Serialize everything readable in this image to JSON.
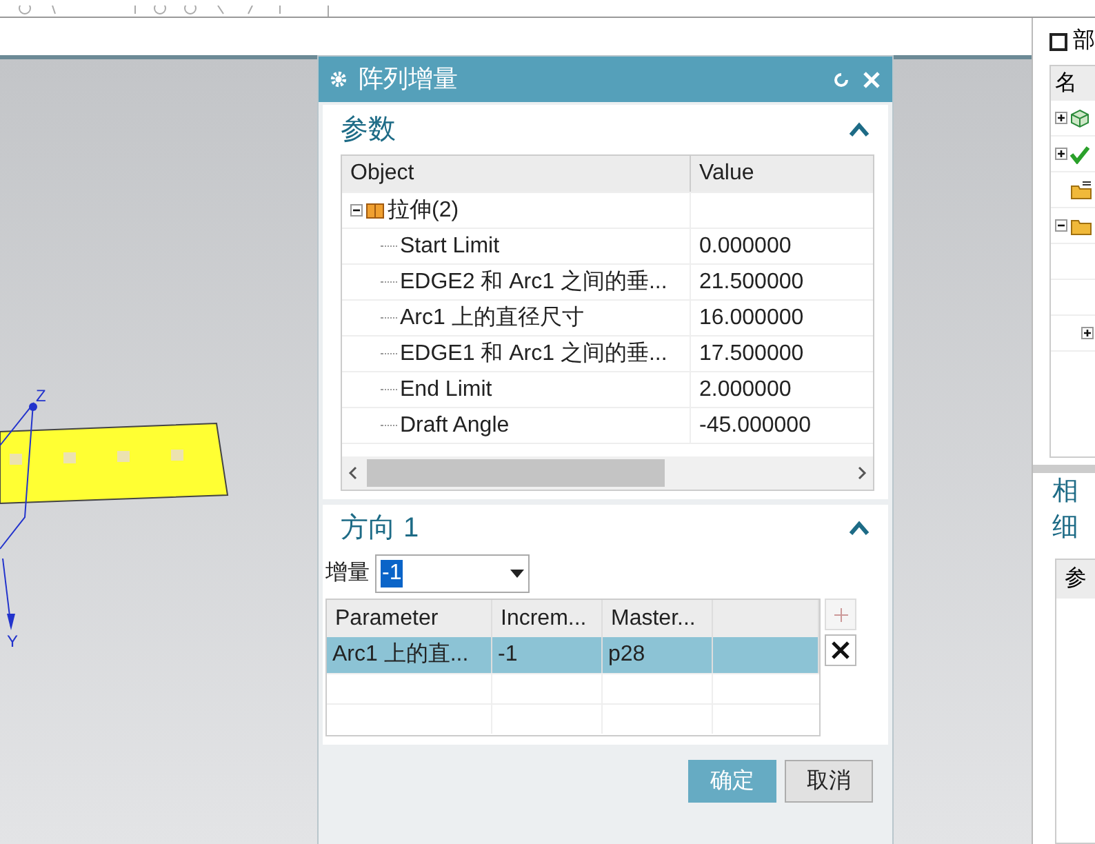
{
  "viewport": {
    "axis_labels": [
      "Z",
      "Y"
    ]
  },
  "dialog": {
    "title": "阵列增量",
    "parameters_section": {
      "title": "参数",
      "expanded": true,
      "table": {
        "columns": [
          "Object",
          "Value"
        ],
        "rows": [
          {
            "object": "拉伸(2)",
            "value": "",
            "expanded": true,
            "children": [
              {
                "object": "Start Limit",
                "value": "0.000000"
              },
              {
                "object": "EDGE2 和 Arc1 之间的垂...",
                "value": "21.500000"
              },
              {
                "object": "Arc1 上的直径尺寸",
                "value": "16.000000"
              },
              {
                "object": "EDGE1 和 Arc1 之间的垂...",
                "value": "17.500000"
              },
              {
                "object": "End Limit",
                "value": "2.000000"
              },
              {
                "object": "Draft Angle",
                "value": "-45.000000"
              }
            ]
          }
        ]
      }
    },
    "direction_section": {
      "title": "方向 1",
      "expanded": true,
      "increment_label": "增量",
      "increment_value": "-1",
      "table": {
        "columns": [
          "Parameter",
          "Increm...",
          "Master...",
          ""
        ],
        "rows": [
          {
            "cells": [
              "Arc1 上的直...",
              "-1",
              "p28",
              ""
            ],
            "selected": true
          }
        ]
      }
    },
    "buttons": [
      {
        "label": "确定",
        "primary": true
      },
      {
        "label": "取消",
        "primary": false
      }
    ]
  },
  "right_panel": {
    "title": "部",
    "tree_header": "名",
    "tree_rows": [
      {
        "kind": "body",
        "expanded": false
      },
      {
        "kind": "check",
        "expanded": false
      },
      {
        "kind": "folder-doc"
      },
      {
        "kind": "folder",
        "expanded": true
      },
      {
        "kind": "blank"
      },
      {
        "kind": "blank"
      },
      {
        "kind": "blank",
        "expanded": false
      }
    ],
    "related": "相",
    "details": "细",
    "details_header": "参"
  }
}
